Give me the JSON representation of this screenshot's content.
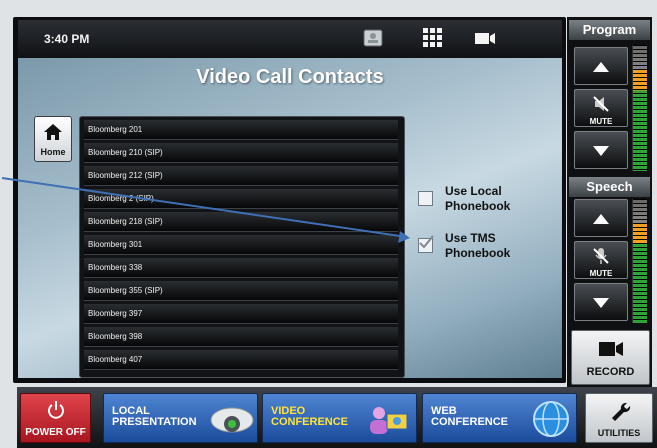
{
  "status_bar": {
    "time": "3:40 PM",
    "icons": [
      "contacts-card-icon",
      "keypad-grid-icon",
      "video-camera-icon"
    ]
  },
  "page": {
    "title": "Video Call Contacts"
  },
  "home_button": {
    "label": "Home",
    "icon": "home-icon"
  },
  "contacts": [
    "Bloomberg 201",
    "Bloomberg 210 (SIP)",
    "Bloomberg 212 (SIP)",
    "Bloomberg 2 (SIP)",
    "Bloomberg 218 (SIP)",
    "Bloomberg 301",
    "Bloomberg 338",
    "Bloomberg 355 (SIP)",
    "Bloomberg 397",
    "Bloomberg 398",
    "Bloomberg 407"
  ],
  "phonebook_options": [
    {
      "line1": "Use Local",
      "line2": "Phonebook",
      "checked": false
    },
    {
      "line1": "Use TMS",
      "line2": "Phonebook",
      "checked": true
    }
  ],
  "program": {
    "header": "Program",
    "mute_label": "MUTE",
    "level": 0.72
  },
  "speech": {
    "header": "Speech",
    "mute_label": "MUTE",
    "level": 0.72
  },
  "record": {
    "label": "RECORD"
  },
  "bottom_bar": {
    "power": {
      "label": "POWER OFF"
    },
    "local_presentation": {
      "line1": "LOCAL",
      "line2": "PRESENTATION"
    },
    "video_conference": {
      "line1": "VIDEO",
      "line2": "CONFERENCE"
    },
    "web_conference": {
      "line1": "WEB",
      "line2": "CONFERENCE"
    },
    "utilities": {
      "label": "UTILITIES"
    }
  },
  "colors": {
    "accent_yellow": "#ffe43a",
    "power_red": "#c9232c",
    "source_blue": "#2d63b6",
    "meter_green": "#2fa238",
    "meter_orange": "#f0a020",
    "callout_arrow": "#3f6fb5"
  }
}
